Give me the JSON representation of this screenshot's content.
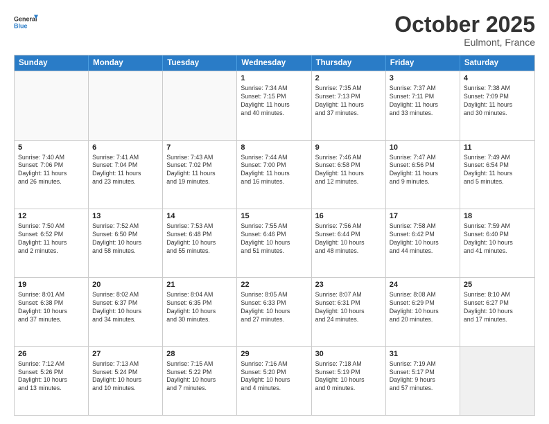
{
  "header": {
    "logo_line1": "General",
    "logo_line2": "Blue",
    "month_title": "October 2025",
    "location": "Eulmont, France"
  },
  "days_of_week": [
    "Sunday",
    "Monday",
    "Tuesday",
    "Wednesday",
    "Thursday",
    "Friday",
    "Saturday"
  ],
  "weeks": [
    [
      {
        "day": "",
        "info": ""
      },
      {
        "day": "",
        "info": ""
      },
      {
        "day": "",
        "info": ""
      },
      {
        "day": "1",
        "info": "Sunrise: 7:34 AM\nSunset: 7:15 PM\nDaylight: 11 hours\nand 40 minutes."
      },
      {
        "day": "2",
        "info": "Sunrise: 7:35 AM\nSunset: 7:13 PM\nDaylight: 11 hours\nand 37 minutes."
      },
      {
        "day": "3",
        "info": "Sunrise: 7:37 AM\nSunset: 7:11 PM\nDaylight: 11 hours\nand 33 minutes."
      },
      {
        "day": "4",
        "info": "Sunrise: 7:38 AM\nSunset: 7:09 PM\nDaylight: 11 hours\nand 30 minutes."
      }
    ],
    [
      {
        "day": "5",
        "info": "Sunrise: 7:40 AM\nSunset: 7:06 PM\nDaylight: 11 hours\nand 26 minutes."
      },
      {
        "day": "6",
        "info": "Sunrise: 7:41 AM\nSunset: 7:04 PM\nDaylight: 11 hours\nand 23 minutes."
      },
      {
        "day": "7",
        "info": "Sunrise: 7:43 AM\nSunset: 7:02 PM\nDaylight: 11 hours\nand 19 minutes."
      },
      {
        "day": "8",
        "info": "Sunrise: 7:44 AM\nSunset: 7:00 PM\nDaylight: 11 hours\nand 16 minutes."
      },
      {
        "day": "9",
        "info": "Sunrise: 7:46 AM\nSunset: 6:58 PM\nDaylight: 11 hours\nand 12 minutes."
      },
      {
        "day": "10",
        "info": "Sunrise: 7:47 AM\nSunset: 6:56 PM\nDaylight: 11 hours\nand 9 minutes."
      },
      {
        "day": "11",
        "info": "Sunrise: 7:49 AM\nSunset: 6:54 PM\nDaylight: 11 hours\nand 5 minutes."
      }
    ],
    [
      {
        "day": "12",
        "info": "Sunrise: 7:50 AM\nSunset: 6:52 PM\nDaylight: 11 hours\nand 2 minutes."
      },
      {
        "day": "13",
        "info": "Sunrise: 7:52 AM\nSunset: 6:50 PM\nDaylight: 10 hours\nand 58 minutes."
      },
      {
        "day": "14",
        "info": "Sunrise: 7:53 AM\nSunset: 6:48 PM\nDaylight: 10 hours\nand 55 minutes."
      },
      {
        "day": "15",
        "info": "Sunrise: 7:55 AM\nSunset: 6:46 PM\nDaylight: 10 hours\nand 51 minutes."
      },
      {
        "day": "16",
        "info": "Sunrise: 7:56 AM\nSunset: 6:44 PM\nDaylight: 10 hours\nand 48 minutes."
      },
      {
        "day": "17",
        "info": "Sunrise: 7:58 AM\nSunset: 6:42 PM\nDaylight: 10 hours\nand 44 minutes."
      },
      {
        "day": "18",
        "info": "Sunrise: 7:59 AM\nSunset: 6:40 PM\nDaylight: 10 hours\nand 41 minutes."
      }
    ],
    [
      {
        "day": "19",
        "info": "Sunrise: 8:01 AM\nSunset: 6:38 PM\nDaylight: 10 hours\nand 37 minutes."
      },
      {
        "day": "20",
        "info": "Sunrise: 8:02 AM\nSunset: 6:37 PM\nDaylight: 10 hours\nand 34 minutes."
      },
      {
        "day": "21",
        "info": "Sunrise: 8:04 AM\nSunset: 6:35 PM\nDaylight: 10 hours\nand 30 minutes."
      },
      {
        "day": "22",
        "info": "Sunrise: 8:05 AM\nSunset: 6:33 PM\nDaylight: 10 hours\nand 27 minutes."
      },
      {
        "day": "23",
        "info": "Sunrise: 8:07 AM\nSunset: 6:31 PM\nDaylight: 10 hours\nand 24 minutes."
      },
      {
        "day": "24",
        "info": "Sunrise: 8:08 AM\nSunset: 6:29 PM\nDaylight: 10 hours\nand 20 minutes."
      },
      {
        "day": "25",
        "info": "Sunrise: 8:10 AM\nSunset: 6:27 PM\nDaylight: 10 hours\nand 17 minutes."
      }
    ],
    [
      {
        "day": "26",
        "info": "Sunrise: 7:12 AM\nSunset: 5:26 PM\nDaylight: 10 hours\nand 13 minutes."
      },
      {
        "day": "27",
        "info": "Sunrise: 7:13 AM\nSunset: 5:24 PM\nDaylight: 10 hours\nand 10 minutes."
      },
      {
        "day": "28",
        "info": "Sunrise: 7:15 AM\nSunset: 5:22 PM\nDaylight: 10 hours\nand 7 minutes."
      },
      {
        "day": "29",
        "info": "Sunrise: 7:16 AM\nSunset: 5:20 PM\nDaylight: 10 hours\nand 4 minutes."
      },
      {
        "day": "30",
        "info": "Sunrise: 7:18 AM\nSunset: 5:19 PM\nDaylight: 10 hours\nand 0 minutes."
      },
      {
        "day": "31",
        "info": "Sunrise: 7:19 AM\nSunset: 5:17 PM\nDaylight: 9 hours\nand 57 minutes."
      },
      {
        "day": "",
        "info": ""
      }
    ]
  ]
}
